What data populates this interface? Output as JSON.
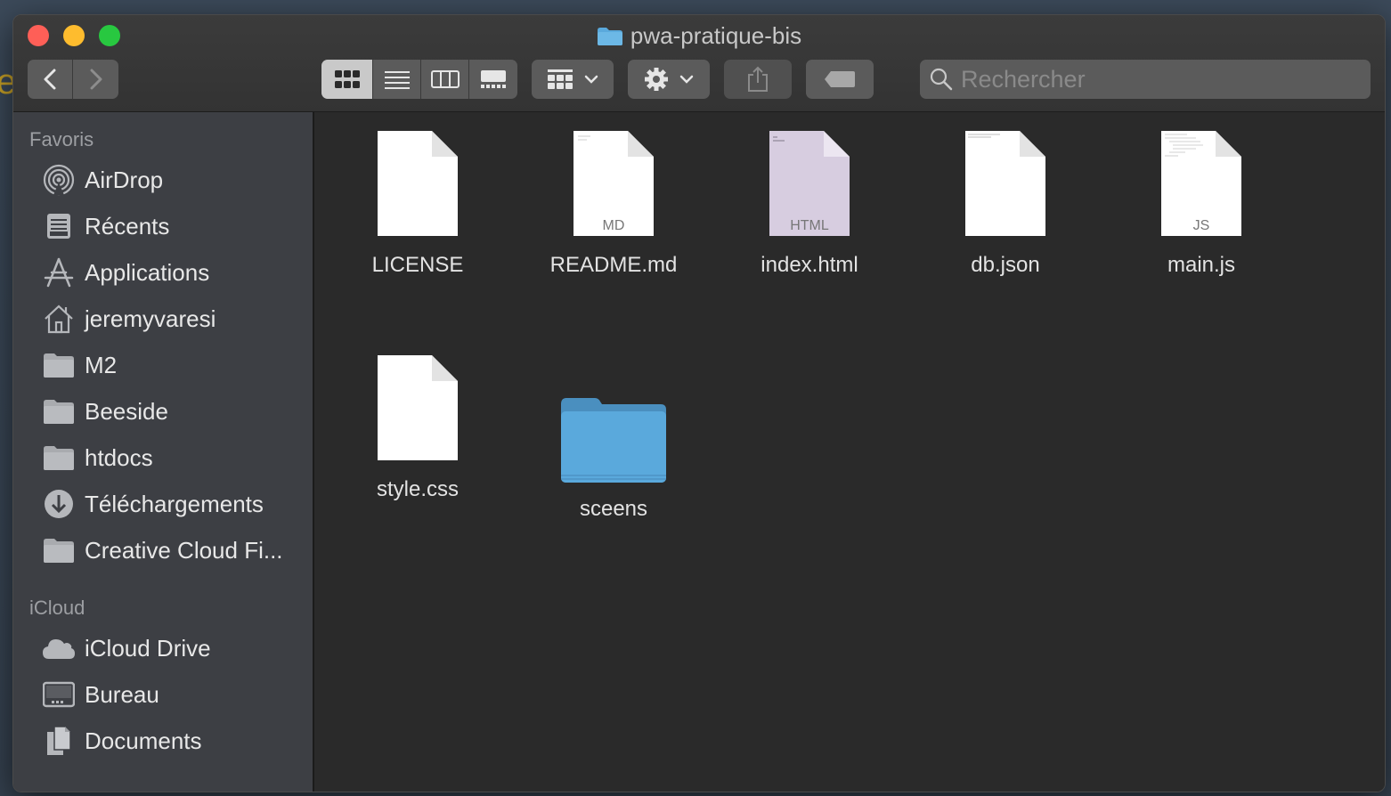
{
  "window": {
    "title": "pwa-pratique-bis"
  },
  "toolbar": {
    "back_icon": "chevron-left-icon",
    "forward_icon": "chevron-right-icon",
    "views": [
      "icon-view",
      "list-view",
      "column-view",
      "gallery-view"
    ],
    "active_view": "icon-view",
    "group_icon": "group-grid-icon",
    "action_icon": "gear-icon",
    "share_icon": "share-icon",
    "tag_icon": "tag-icon"
  },
  "search": {
    "placeholder": "Rechercher"
  },
  "sidebar": {
    "favorites_label": "Favoris",
    "favorites": [
      {
        "label": "AirDrop",
        "icon": "airdrop-icon"
      },
      {
        "label": "Récents",
        "icon": "recents-icon"
      },
      {
        "label": "Applications",
        "icon": "applications-icon"
      },
      {
        "label": "jeremyvaresi",
        "icon": "home-icon"
      },
      {
        "label": "M2",
        "icon": "folder-icon"
      },
      {
        "label": "Beeside",
        "icon": "folder-icon"
      },
      {
        "label": "htdocs",
        "icon": "folder-icon"
      },
      {
        "label": "Téléchargements",
        "icon": "downloads-icon"
      },
      {
        "label": "Creative Cloud Fi...",
        "icon": "folder-icon"
      }
    ],
    "icloud_label": "iCloud",
    "icloud": [
      {
        "label": "iCloud Drive",
        "icon": "cloud-icon"
      },
      {
        "label": "Bureau",
        "icon": "desktop-icon"
      },
      {
        "label": "Documents",
        "icon": "documents-icon"
      }
    ]
  },
  "files": [
    {
      "name": "LICENSE",
      "badge": "",
      "kind": "document"
    },
    {
      "name": "README.md",
      "badge": "MD",
      "kind": "document"
    },
    {
      "name": "index.html",
      "badge": "HTML",
      "kind": "document"
    },
    {
      "name": "db.json",
      "badge": "",
      "kind": "document"
    },
    {
      "name": "main.js",
      "badge": "JS",
      "kind": "document"
    },
    {
      "name": "style.css",
      "badge": "",
      "kind": "document"
    },
    {
      "name": "sceens",
      "badge": "",
      "kind": "folder"
    }
  ],
  "colors": {
    "folder_blue": "#5aa9dc",
    "html_tint": "#d7cde0",
    "close": "#fe5f57",
    "minimize": "#febc2e",
    "maximize": "#28c840"
  }
}
